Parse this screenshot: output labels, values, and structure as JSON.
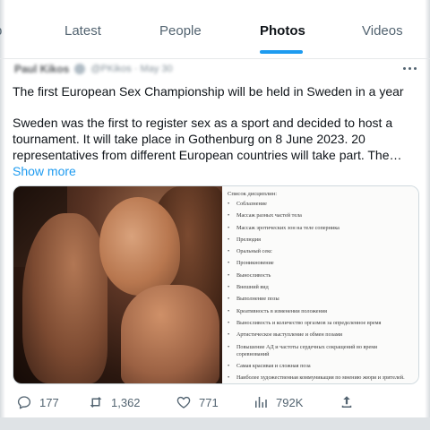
{
  "tabs": {
    "partial": "p",
    "latest": "Latest",
    "people": "People",
    "photos": "Photos",
    "videos": "Videos",
    "active": "Photos"
  },
  "tweet": {
    "author_name": "Paul Kikos",
    "author_handle": "@PKikos · May 30",
    "headline": "The first European Sex Championship will be held in Sweden in a year",
    "body": "Sweden was the first to register sex as a sport and decided to host a tournament. It will take place in Gothenburg on 8 June 2023. 20 representatives from different European countries will take part. The…",
    "show_more": "Show more"
  },
  "document": {
    "title": "Список дисциплин:",
    "items": [
      "Соблазнение",
      "Массаж разных частей тела",
      "Массаж эротических зон на теле соперника",
      "Прелюдия",
      "Оральный секс",
      "Проникновение",
      "Выносливость",
      "Внешний вид",
      "Выполнение позы",
      "Креативность в изменении положения",
      "Выносливость и количество оргазмов за определенное время",
      "Артистическое выступление и обмен позами",
      "Повышение АД и частоты сердечных сокращений во время соревнований",
      "Самая красивая и сложная поза",
      "Наиболее художественная коммуникация по мнению жюри и зрителей."
    ]
  },
  "actions": {
    "replies": "177",
    "retweets": "1,362",
    "likes": "771",
    "views": "792K"
  },
  "icons": {
    "reply": "reply-icon",
    "retweet": "retweet-icon",
    "like": "heart-icon",
    "views": "views-icon",
    "share": "share-icon",
    "more": "more-icon"
  },
  "colors": {
    "accent": "#1d9bf0",
    "text_primary": "#0f1419",
    "text_secondary": "#536471"
  }
}
